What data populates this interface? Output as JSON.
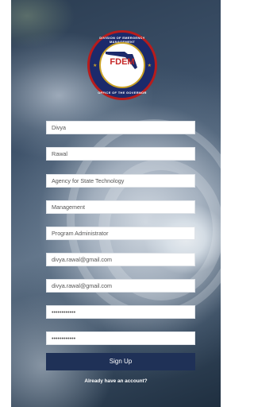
{
  "logo": {
    "ring_top": "DIVISION OF EMERGENCY MANAGEMENT",
    "title": "FDEM",
    "ring_bottom": "OFFICE OF THE GOVERNOR"
  },
  "form": {
    "first_name": "Divya",
    "last_name": "Rawal",
    "agency": "Agency for State Technology",
    "department": "Management",
    "title": "Program Administrator",
    "email": "divya.rawal@gmail.com",
    "confirm_email": "divya.rawal@gmail.com",
    "password": "••••••••••••",
    "confirm_password": "••••••••••••"
  },
  "actions": {
    "signup_label": "Sign Up",
    "account_link": "Already have an account?"
  },
  "colors": {
    "button": "#1f3157",
    "logo_blue": "#1c2a6b",
    "logo_red": "#c62828"
  }
}
